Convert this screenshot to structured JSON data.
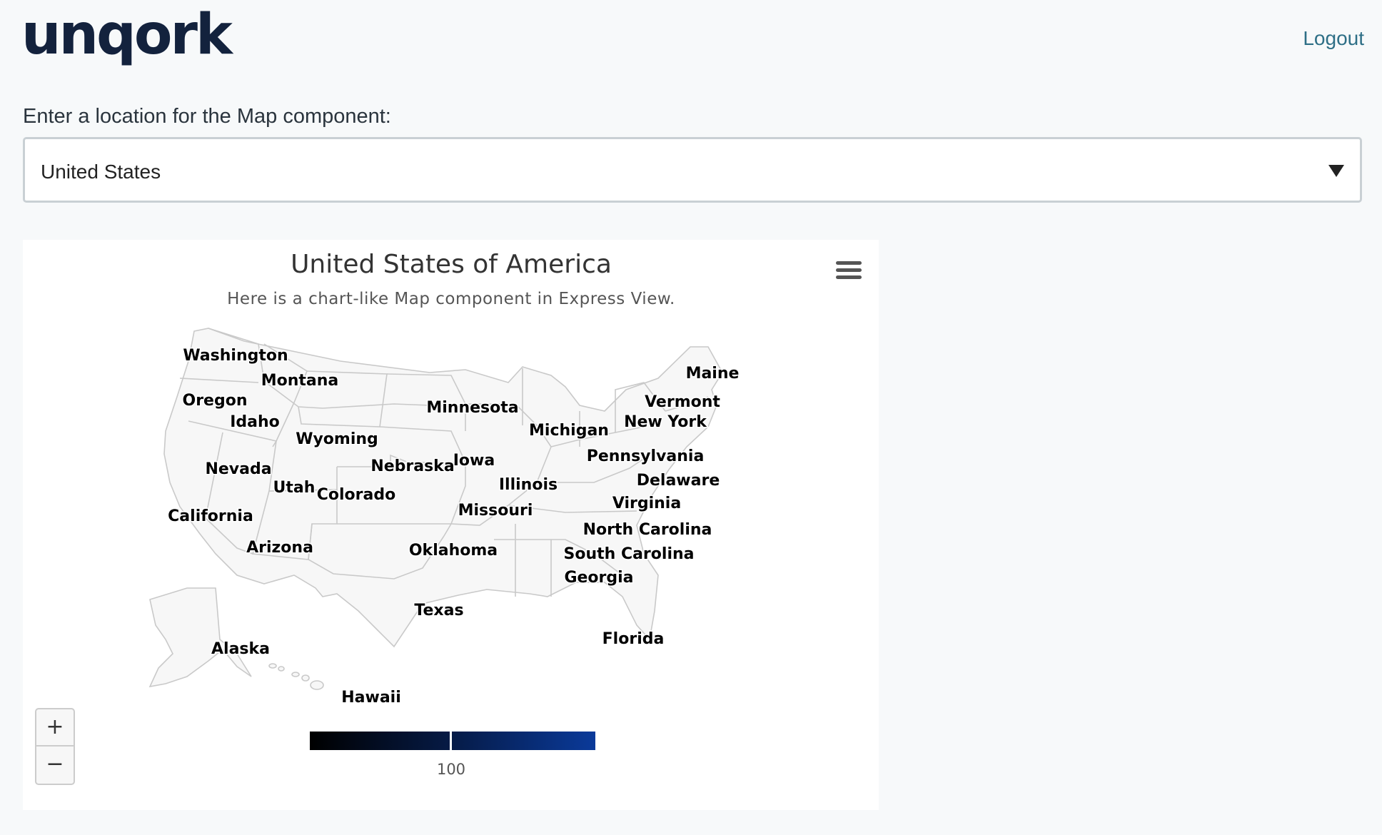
{
  "header": {
    "logo": "unqork",
    "logout": "Logout"
  },
  "form": {
    "label": "Enter a location for the Map component:",
    "select_value": "United States"
  },
  "map": {
    "title": "United States of America",
    "subtitle": "Here is a chart-like Map component in Express View.",
    "zoom_in": "+",
    "zoom_out": "−",
    "legend": {
      "label": "100",
      "colors": [
        "#000000",
        "#061b47",
        "#0a3a9a"
      ]
    },
    "states": [
      "Washington",
      "Oregon",
      "Montana",
      "Idaho",
      "Wyoming",
      "Nevada",
      "Utah",
      "Colorado",
      "California",
      "Arizona",
      "Minnesota",
      "Nebraska",
      "Iowa",
      "Illinois",
      "Missouri",
      "Oklahoma",
      "Texas",
      "Michigan",
      "Maine",
      "Vermont",
      "New York",
      "Pennsylvania",
      "Delaware",
      "Virginia",
      "North Carolina",
      "South Carolina",
      "Georgia",
      "Florida",
      "Alaska",
      "Hawaii"
    ]
  },
  "colors": {
    "logo": "#13223d",
    "link": "#2e6f86",
    "background": "#f7f9fa"
  }
}
